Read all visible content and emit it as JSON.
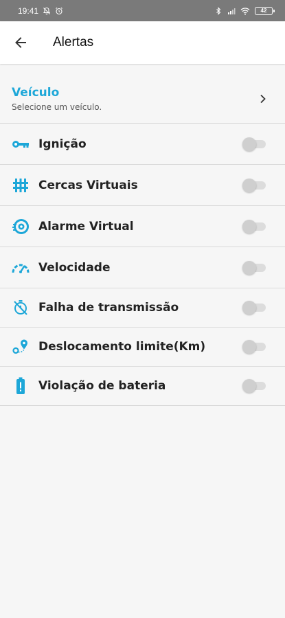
{
  "status_bar": {
    "time": "19:41",
    "battery": "42"
  },
  "app_bar": {
    "title": "Alertas"
  },
  "vehicle": {
    "title": "Veículo",
    "subtitle": "Selecione um veículo."
  },
  "alerts": [
    {
      "label": "Ignição",
      "icon": "key-icon",
      "enabled": false
    },
    {
      "label": "Cercas Virtuais",
      "icon": "fence-icon",
      "enabled": false
    },
    {
      "label": "Alarme Virtual",
      "icon": "alarm-icon",
      "enabled": false
    },
    {
      "label": "Velocidade",
      "icon": "speedometer-icon",
      "enabled": false
    },
    {
      "label": "Falha de transmissão",
      "icon": "transmission-off-icon",
      "enabled": false
    },
    {
      "label": "Deslocamento limite(Km)",
      "icon": "route-pin-icon",
      "enabled": false
    },
    {
      "label": "Violação de bateria",
      "icon": "battery-alert-icon",
      "enabled": false
    }
  ],
  "colors": {
    "accent": "#1da7d8",
    "status_bar": "#7a7a7a",
    "background": "#f6f6f6"
  }
}
